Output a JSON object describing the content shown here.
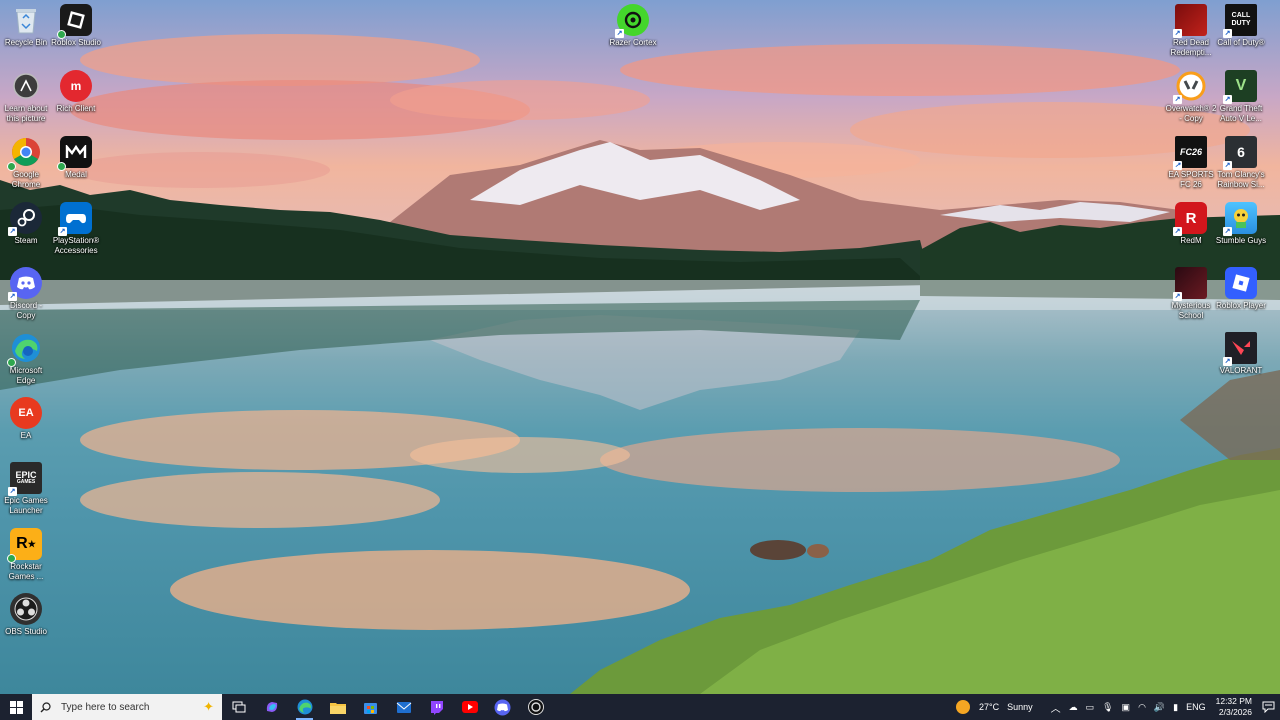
{
  "desktop": {
    "icons_left_col1": [
      {
        "label": "Recycle Bin",
        "icon": "recycle-bin-icon"
      },
      {
        "label": "Learn about this picture",
        "icon": "learn-picture-icon"
      },
      {
        "label": "Google Chrome",
        "icon": "chrome-icon"
      },
      {
        "label": "Steam",
        "icon": "steam-icon"
      },
      {
        "label": "Discord - Copy",
        "icon": "discord-icon"
      },
      {
        "label": "Microsoft Edge",
        "icon": "edge-icon"
      },
      {
        "label": "EA",
        "icon": "ea-icon"
      },
      {
        "label": "Epic Games Launcher",
        "icon": "epic-games-icon"
      },
      {
        "label": "Rockstar Games ...",
        "icon": "rockstar-icon"
      },
      {
        "label": "OBS Studio",
        "icon": "obs-icon"
      }
    ],
    "icons_left_col2": [
      {
        "label": "Roblox Studio",
        "icon": "roblox-studio-icon"
      },
      {
        "label": "Rich Client",
        "icon": "rich-client-icon"
      },
      {
        "label": "Medal",
        "icon": "medal-icon"
      },
      {
        "label": "PlayStation® Accessories",
        "icon": "playstation-icon"
      }
    ],
    "icon_top_center": {
      "label": "Razer Cortex",
      "icon": "razer-cortex-icon"
    },
    "icons_right_col1": [
      {
        "label": "Red Dead Redempti...",
        "icon": "red-dead-icon"
      },
      {
        "label": "Overwatch® 2 - Copy",
        "icon": "overwatch-icon"
      },
      {
        "label": "EA SPORTS FC 26",
        "icon": "ea-fc-icon",
        "tile_text": "FC26"
      },
      {
        "label": "RedM",
        "icon": "redm-icon"
      },
      {
        "label": "Mysterious School",
        "icon": "mysterious-school-icon"
      }
    ],
    "icons_right_col2": [
      {
        "label": "Call of Duty®",
        "icon": "call-of-duty-icon",
        "tile_text": "CALL DUTY"
      },
      {
        "label": "Grand Theft Auto V Le...",
        "icon": "gta-v-icon"
      },
      {
        "label": "Tom Clancy's Rainbow Si...",
        "icon": "rainbow-six-icon"
      },
      {
        "label": "Stumble Guys",
        "icon": "stumble-guys-icon"
      },
      {
        "label": "Roblox Player",
        "icon": "roblox-player-icon"
      },
      {
        "label": "VALORANT",
        "icon": "valorant-icon"
      }
    ]
  },
  "taskbar": {
    "search_placeholder": "Type here to search",
    "apps": [
      "task-view-icon",
      "copilot-icon",
      "edge-icon",
      "file-explorer-icon",
      "microsoft-store-icon",
      "mail-icon",
      "twitch-icon",
      "youtube-icon",
      "discord-icon",
      "razer-cortex-icon"
    ],
    "weather": {
      "temp": "27°C",
      "condition": "Sunny"
    },
    "language": "ENG",
    "time": "12:32 PM",
    "date": "2/3/2026"
  }
}
